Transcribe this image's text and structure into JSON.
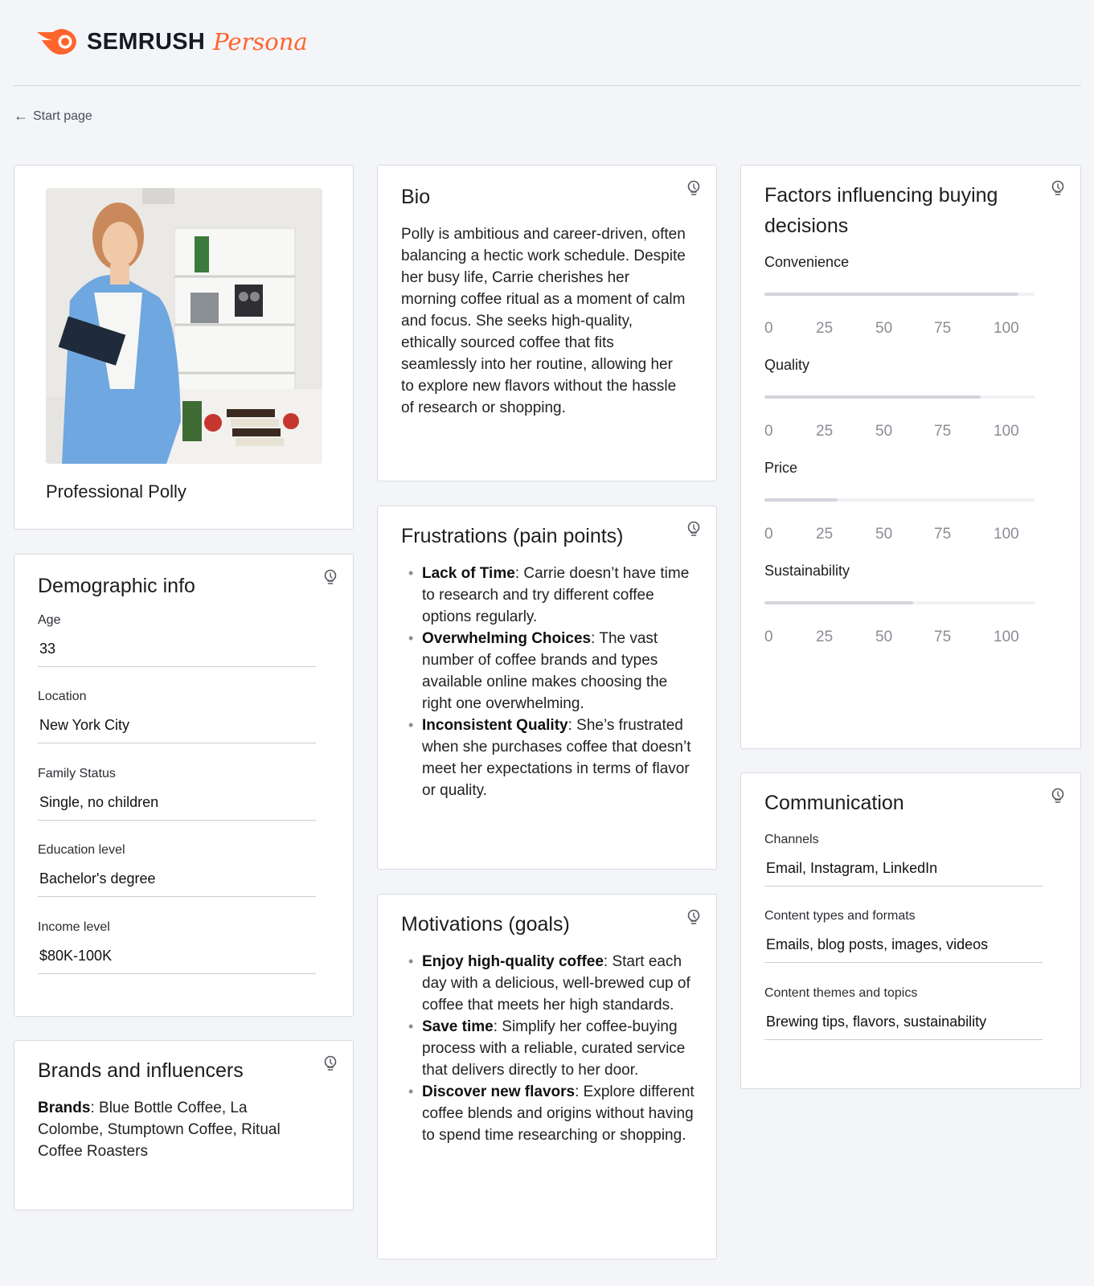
{
  "header": {
    "brand": "SEMRUSH",
    "product": "Persona",
    "brand_color": "#ff642d",
    "back_label": "Start page"
  },
  "profile": {
    "name": "Professional Polly"
  },
  "demographics": {
    "title": "Demographic info",
    "fields": [
      {
        "label": "Age",
        "value": "33"
      },
      {
        "label": "Location",
        "value": "New York City"
      },
      {
        "label": "Family Status",
        "value": "Single, no children"
      },
      {
        "label": "Education level",
        "value": "Bachelor's degree"
      },
      {
        "label": "Income level",
        "value": "$80K-100K"
      }
    ]
  },
  "brands": {
    "title": "Brands and influencers",
    "label": "Brands",
    "text": ": Blue Bottle Coffee, La Colombe, Stumptown Coffee, Ritual Coffee Roasters"
  },
  "bio": {
    "title": "Bio",
    "text": "Polly is ambitious and career-driven, often balancing a hectic work schedule. Despite her busy life, Carrie cherishes her morning coffee ritual as a moment of calm and focus. She seeks high-quality, ethically sourced coffee that fits seamlessly into her routine, allowing her to explore new flavors without the hassle of research or shopping."
  },
  "frustrations": {
    "title": "Frustrations (pain points)",
    "items": [
      {
        "bold": "Lack of Time",
        "text": ": Carrie doesn’t have time to research and try different coffee options regularly."
      },
      {
        "bold": "Overwhelming Choices",
        "text": ": The vast number of coffee brands and types available online makes choosing the right one overwhelming."
      },
      {
        "bold": "Inconsistent Quality",
        "text": ": She’s frustrated when she purchases coffee that doesn’t meet her expectations in terms of flavor or quality."
      }
    ]
  },
  "motivations": {
    "title": "Motivations (goals)",
    "items": [
      {
        "bold": "Enjoy high-quality coffee",
        "text": ": Start each day with a delicious, well-brewed cup of coffee that meets her high standards."
      },
      {
        "bold": "Save time",
        "text": ": Simplify her coffee-buying process with a reliable, curated service that delivers directly to her door."
      },
      {
        "bold": "Discover new flavors",
        "text": ": Explore different coffee blends and origins without having to spend time researching or shopping."
      }
    ]
  },
  "factors": {
    "title": "Factors influencing buying decisions",
    "scale": [
      "0",
      "25",
      "50",
      "75",
      "100"
    ],
    "items": [
      {
        "label": "Convenience",
        "value": 94
      },
      {
        "label": "Quality",
        "value": 80
      },
      {
        "label": "Price",
        "value": 27
      },
      {
        "label": "Sustainability",
        "value": 55
      }
    ]
  },
  "communication": {
    "title": "Communication",
    "fields": [
      {
        "label": "Channels",
        "value": "Email, Instagram, LinkedIn"
      },
      {
        "label": "Content types and formats",
        "value": "Emails, blog posts, images, videos"
      },
      {
        "label": "Content themes and topics",
        "value": "Brewing tips, flavors, sustainability"
      }
    ]
  }
}
